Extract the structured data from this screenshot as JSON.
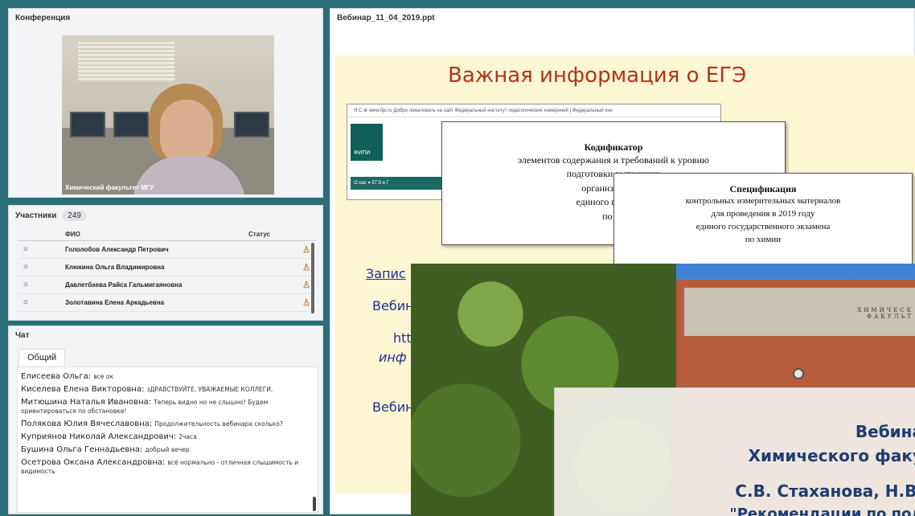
{
  "conference": {
    "title": "Конференция",
    "video_label": "Химический факультет МГУ"
  },
  "participants": {
    "title": "Участники",
    "count": "249",
    "columns": {
      "name": "ФИО",
      "status": "Статус"
    },
    "rows": [
      {
        "name": "Гололобов Александр Петрович"
      },
      {
        "name": "Клюкина Ольга Владимировна"
      },
      {
        "name": "Давлетбаева Райса Гальмигаяновна"
      },
      {
        "name": "Золотавина Елена Аркадьевна"
      }
    ],
    "drag_glyph": "≡",
    "status_icon": "person-icon"
  },
  "chat": {
    "title": "Чат",
    "tab": "Общий",
    "messages": [
      {
        "author": "Елисеева Ольга:",
        "text": "все ок"
      },
      {
        "author": "Киселева Елена Викторовна:",
        "text": "зДРАВСТВУЙТЕ, УВАЖАЕМЫЕ КОЛЛЕГИ."
      },
      {
        "author": "Митюшина  Наталья Ивановна:",
        "text": "Теперь видно но не слышно! Будем ориентироваться по обстановке!"
      },
      {
        "author": "Полякова Юлия Вячеславовна:",
        "text": "Продолжительность вебинара сколько?"
      },
      {
        "author": "Куприянов Николай Александрович:",
        "text": "2часа"
      },
      {
        "author": "Бушина Ольга Геннадьевна:",
        "text": "добрый вечер"
      },
      {
        "author": "Осетрова Оксана Александровна:",
        "text": "всё нормально - отличная слышимость и видимость"
      }
    ]
  },
  "presentation": {
    "file_title": "Вебинар_11_04_2019.ppt",
    "slide_title": "Важная информация о ЕГЭ",
    "browser_bar": "Я  С  ⊕  www.fipi.ru  Добро пожаловать на сайт Федеральный институт педагогических измерений | Федеральный инс",
    "browser_logo": "ФИПИ",
    "browser_nav": "О нас ▾     ЕГЭ и Г",
    "codifier": {
      "heading": "Кодификатор",
      "lines": [
        "элементов содержания и требований к уровню",
        "подготовки выпускник",
        "организаций дл",
        "единого государст",
        "по хи"
      ]
    },
    "spec": {
      "heading": "Спецификация",
      "lines": [
        "контрольных измерительных материалов",
        "для проведения в 2019 году",
        "единого государственного экзамена",
        "по химии"
      ]
    },
    "slide_text": [
      "Запис",
      "Вебин",
      "htt",
      "инф",
      "Вебин"
    ],
    "photo": {
      "facade_text": "ХИМИЧЕСК\nФАКУЛЬТ",
      "line1": "Вебина",
      "line2": "Химического факу",
      "line3": "С.В. Стаханова, Н.В.",
      "line4": "\"Рекомендации по под"
    }
  },
  "colors": {
    "background": "#2a6f78",
    "slide_title": "#b0341a",
    "slide_text": "#1d2f8a"
  }
}
